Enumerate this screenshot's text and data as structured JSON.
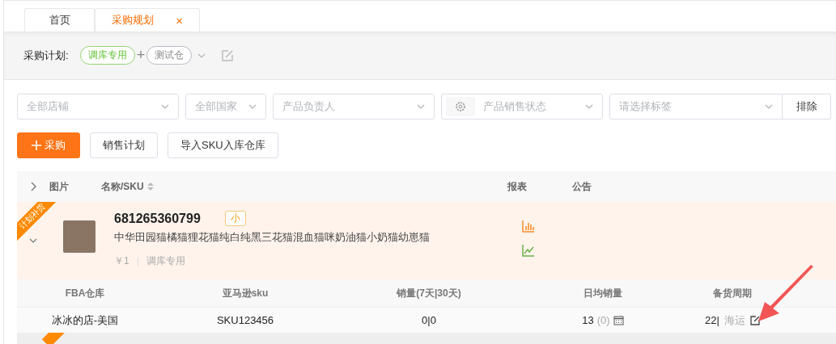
{
  "tabs": [
    {
      "label": "首页",
      "selected": false
    },
    {
      "label": "采购规划",
      "selected": true,
      "close": "×"
    }
  ],
  "plan": {
    "label": "采购计划:",
    "tags": [
      {
        "text": "调库专用",
        "color": "#95d475"
      },
      {
        "text": "测试仓",
        "color": "#b8bcc4"
      }
    ],
    "joiner": "+"
  },
  "filters": [
    {
      "kind": "select",
      "placeholder": "全部店铺"
    },
    {
      "kind": "select",
      "placeholder": "全部国家"
    },
    {
      "kind": "select",
      "placeholder": "产品负责人"
    },
    {
      "kind": "select-gear",
      "placeholder": "产品销售状态"
    },
    {
      "kind": "select-button",
      "placeholder": "请选择标签",
      "button": "排除"
    }
  ],
  "actions": [
    {
      "kind": "primary",
      "label": "采购"
    },
    {
      "kind": "plain",
      "label": "销售计划"
    },
    {
      "kind": "plain",
      "label": "导入SKU入库仓库"
    }
  ],
  "table": {
    "columns": [
      {
        "label": "图片",
        "sortable": false
      },
      {
        "label": "名称/SKU",
        "sortable": true
      },
      {
        "label": "报表",
        "sortable": false
      },
      {
        "label": "公告",
        "sortable": false
      }
    ],
    "product": {
      "ribbon": "计划补货",
      "expanded": true,
      "sku": "681265360799",
      "size_tag": "小",
      "name": "中华田园猫橘猫狸花猫纯白纯黑三花猫混血猫咪奶油猫小奶猫幼崽猫",
      "price": "￥1",
      "warehouse": "调库专用"
    },
    "detail_columns": [
      "FBA仓库",
      "亚马逊sku",
      "销量(7天|30天)",
      "日均销量",
      "备货周期"
    ],
    "detail_rows": [
      {
        "store": "冰冰的店-美国",
        "sku": "SKU123456",
        "sales": "0|0",
        "daily": "13",
        "daily_note": "(0)",
        "cycle": "22|",
        "shipping": "海运"
      }
    ]
  }
}
